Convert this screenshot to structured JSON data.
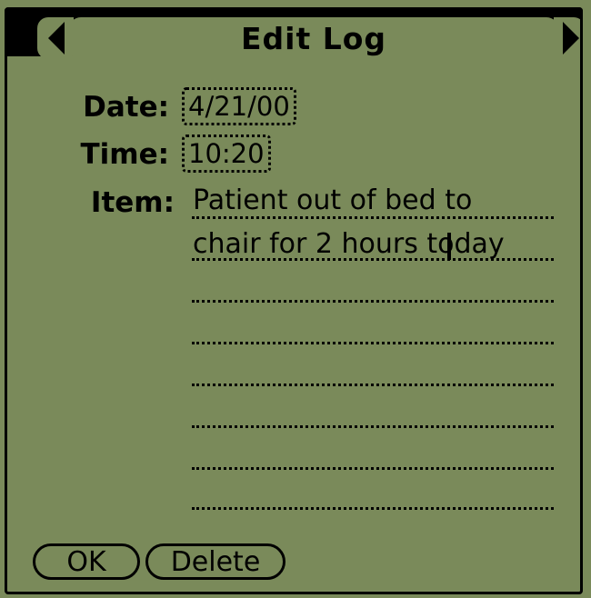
{
  "window": {
    "title": "Edit Log"
  },
  "form": {
    "date_label": "Date:",
    "date_value": "4/21/00",
    "time_label": "Time:",
    "time_value": "10:20",
    "item_label": "Item:",
    "item_lines": [
      "Patient out of bed to",
      "chair for 2 hours today",
      "",
      "",
      "",
      "",
      "",
      ""
    ]
  },
  "buttons": {
    "ok_label": "OK",
    "delete_label": "Delete"
  },
  "icons": {
    "prev": "left-arrow-icon",
    "next": "right-arrow-icon"
  }
}
